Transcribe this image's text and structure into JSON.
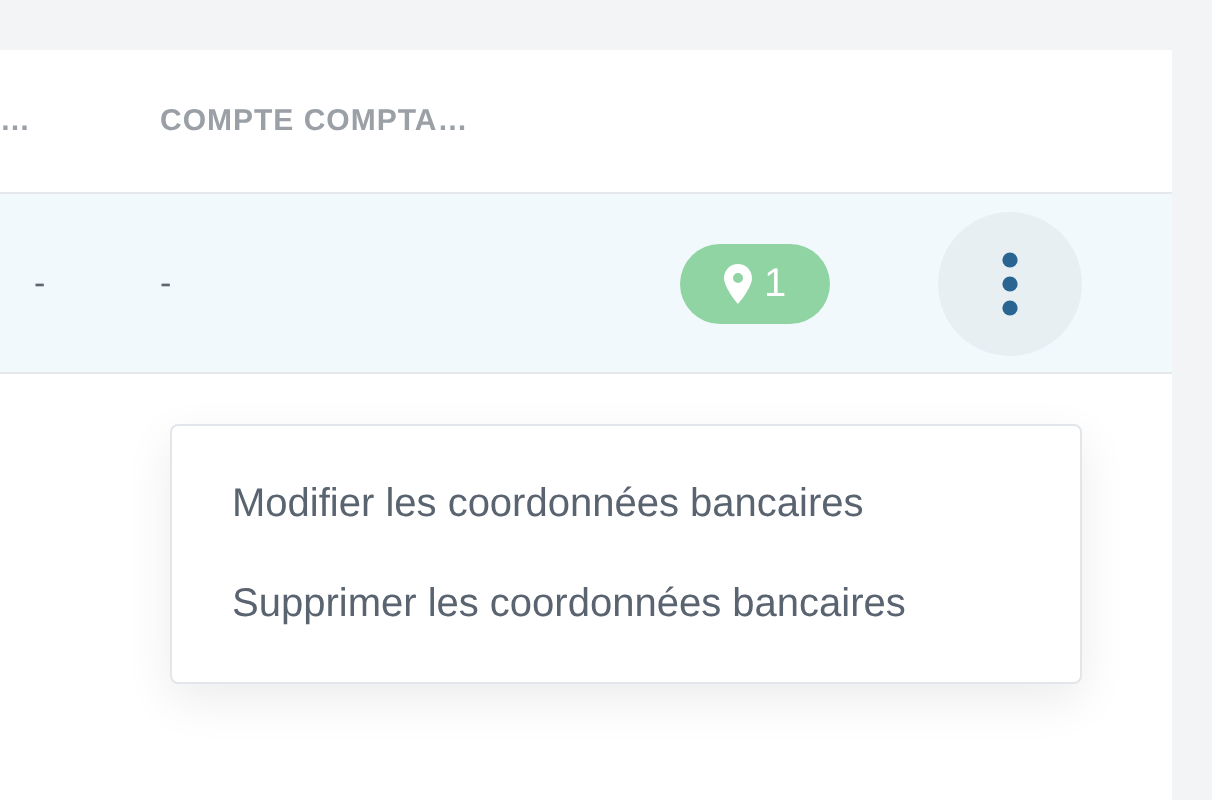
{
  "table": {
    "columns": [
      "…",
      "COMPTE COMPTA…"
    ],
    "rows": [
      {
        "cells": [
          "-",
          "-"
        ],
        "badge": "1",
        "selected": true
      }
    ]
  },
  "menu": {
    "items": [
      "Modifier les coordonnées bancaires",
      "Supprimer les coordonnées bancaires"
    ]
  }
}
